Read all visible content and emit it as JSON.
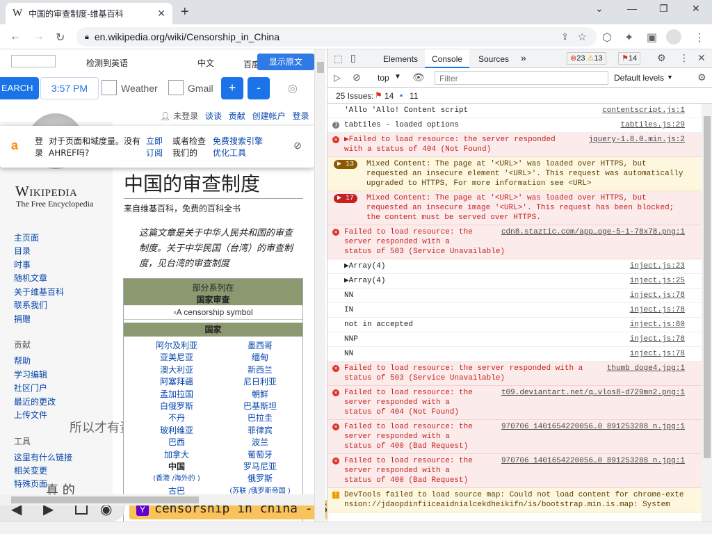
{
  "browser": {
    "tab_title": "中国的审查制度-维基百科",
    "url": "en.wikipedia.org/wiki/Censorship_in_China",
    "tab_close": "✕",
    "new_tab": "+"
  },
  "overlay_toolbar": {
    "search_label": "EARCH",
    "time": "3:57 PM",
    "weather": "Weather",
    "gmail": "Gmail",
    "plus": "+",
    "minus": "-"
  },
  "translate_bar": {
    "detected": "检测到英语",
    "chinese": "中文",
    "baidu": "百度",
    "show_original": "显示原文"
  },
  "ahref_popup": {
    "logo": "a",
    "line1a": "登录",
    "line1b": "对于页面和域度量。没有AHREF吗?",
    "subscribe": "立即订阅",
    "check": "或者检查我们的",
    "free_tool": "免费搜索引擎优化工具"
  },
  "wiki": {
    "personal": {
      "not_logged": "未登录",
      "talk": "谈谈",
      "contrib": "贡献",
      "create": "创建帐户",
      "login": "登录"
    },
    "logo_title": "Wikipedia",
    "logo_sub": "The Free Encyclopedia",
    "page_title": "中国的审查制度",
    "from": "来自维基百科，免费的百科全书",
    "hatnote": "这篇文章是关于中华人民共和国的审查制度。关于中华民国（台湾）的审查制度，见台湾的审查制度",
    "hatnote_link": "台湾的审查制度",
    "nav": [
      "主页面",
      "目录",
      "时事",
      "随机文章",
      "关于维基百科",
      "联系我们",
      "捐赠"
    ],
    "contrib_head": "贡献",
    "contrib": [
      "帮助",
      "学习编辑",
      "社区门户",
      "最近的更改",
      "上传文件"
    ],
    "tools_head": "工具",
    "tools": [
      "这里有什么链接",
      "相关变更",
      "特殊页面"
    ],
    "floating_text": "所以才有资格",
    "floating_text2": "真 的",
    "infobox": {
      "series": "部分系列在",
      "topic": "国家审查",
      "image_alt": "A censorship symbol",
      "countries_head": "国家",
      "left": [
        "阿尔及利亚",
        "亚美尼亚",
        "澳大利亚",
        "阿塞拜疆",
        "孟加拉国",
        "白俄罗斯",
        "不丹",
        "玻利维亚",
        "巴西",
        "加拿大",
        "中国",
        "(香港 /海外的 )",
        "古巴"
      ],
      "right": [
        "墨西哥",
        "缅甸",
        "新西兰",
        "尼日利亚",
        "朝鲜",
        "巴基斯坦",
        "巴拉圭",
        "菲律宾",
        "波兰",
        "葡萄牙",
        "罗马尼亚",
        "俄罗斯",
        "(苏联 /俄罗斯帝国 )"
      ]
    }
  },
  "search_tooltip": "censorship in china - Safe Browser Yahoo Search R...",
  "devtools": {
    "tabs": [
      "Elements",
      "Console",
      "Sources"
    ],
    "err_count": "23",
    "warn_count": "13",
    "issue_count": "14",
    "context": "top",
    "filter_placeholder": "Filter",
    "levels": "Default levels",
    "issues_label": "25 Issues:",
    "issues_err": "14",
    "issues_info": "11",
    "rows": [
      {
        "kind": "plain",
        "text": "'Allo 'Allo! Content script",
        "src": "contentscript.js:1"
      },
      {
        "kind": "group",
        "text": "tabtiles - loaded options",
        "count": "3",
        "src": "tabtiles.js:29"
      },
      {
        "kind": "err",
        "text": "▶Failed to load resource: the server responded\nwith a status of 404 (Not Found)",
        "src": "jquery-1.8.0.min.js:2"
      },
      {
        "kind": "warn",
        "count": "13",
        "text": "Mixed Content: The page at '<URL>' was loaded over HTTPS, but\nrequested an insecure element '<URL>'. This request was automatically\nupgraded to HTTPS, For more information see <URL>",
        "src": ""
      },
      {
        "kind": "errbadge",
        "count": "17",
        "text": "Mixed Content: The page at '<URL>' was loaded over HTTPS, but\nrequested an insecure image '<URL>'. This request has been blocked;\nthe content must be served over HTTPS.",
        "src": ""
      },
      {
        "kind": "err",
        "text": "Failed to load resource: the\nserver responded with a\nstatus of 503 (Service Unavailable)",
        "src": "cdn8.staztic.com/app…oge-5-1-78x78.png:1"
      },
      {
        "kind": "plain",
        "text": "▶Array(4)",
        "src": "inject.js:23"
      },
      {
        "kind": "plain",
        "text": "▶Array(4)",
        "src": "inject.js:25"
      },
      {
        "kind": "plain",
        "text": "NN",
        "src": "inject.js:78"
      },
      {
        "kind": "plain",
        "text": "IN",
        "src": "inject.js:78"
      },
      {
        "kind": "plain",
        "text": "not in accepted",
        "src": "inject.js:80"
      },
      {
        "kind": "plain",
        "text": "NNP",
        "src": "inject.js:78"
      },
      {
        "kind": "plain",
        "text": "NN",
        "src": "inject.js:78"
      },
      {
        "kind": "err",
        "text": "Failed to load resource: the server responded with a\nstatus of 503 (Service Unavailable)",
        "src": "thumb doge4.jpg:1"
      },
      {
        "kind": "err",
        "text": "Failed to load resource: the\nserver responded with a\nstatus of 404 (Not Found)",
        "src": "t09.deviantart.net/q…vlos8-d729mn2.png:1"
      },
      {
        "kind": "err",
        "text": "Failed to load resource: the\nserver responded with a\nstatus of 400 (Bad Request)",
        "src": "970706 1401654220056…0 891253288 n.jpg:1"
      },
      {
        "kind": "err",
        "text": "Failed to load resource: the\nserver responded with a\nstatus of 400 (Bad Request)",
        "src": "970706 1401654220056…0 891253288 n.jpg:1"
      },
      {
        "kind": "warn2",
        "text": "DevTools failed to load source map: Could not load content for chrome-exte\nnsion://jdaopdinfiiceaidnialcekdheikifn/is/bootstrap.min.is.map: System",
        "src": ""
      }
    ]
  }
}
